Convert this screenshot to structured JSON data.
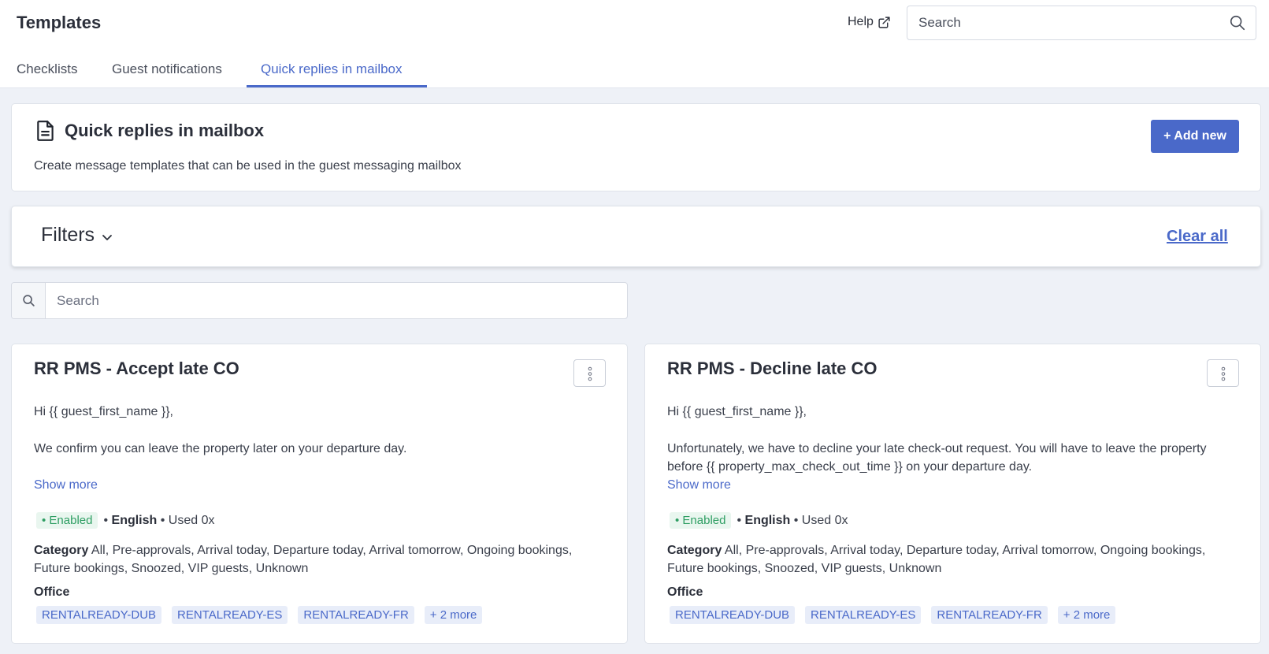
{
  "header": {
    "title": "Templates",
    "help_label": "Help",
    "search_placeholder": "Search"
  },
  "tabs": [
    {
      "label": "Checklists",
      "active": false
    },
    {
      "label": "Guest notifications",
      "active": false
    },
    {
      "label": "Quick replies in mailbox",
      "active": true
    }
  ],
  "section": {
    "title": "Quick replies in mailbox",
    "description": "Create message templates that can be used in the guest messaging mailbox",
    "add_button": "+ Add new"
  },
  "filters": {
    "label": "Filters",
    "clear_all": "Clear all"
  },
  "list_search": {
    "placeholder": "Search"
  },
  "templates": [
    {
      "title": "RR PMS - Accept late CO",
      "greeting": "Hi {{ guest_first_name }},",
      "body": "We confirm you can leave the property later on your departure day.",
      "show_more": "Show more",
      "status": "• Enabled",
      "language": "English",
      "used": "Used 0x",
      "category_label": "Category",
      "category_values": "All, Pre-approvals, Arrival today, Departure today, Arrival tomorrow, Ongoing bookings, Future bookings, Snoozed, VIP guests, Unknown",
      "office_label": "Office",
      "offices": [
        "RENTALREADY-DUB",
        "RENTALREADY-ES",
        "RENTALREADY-FR",
        "+ 2 more"
      ]
    },
    {
      "title": "RR PMS - Decline late CO",
      "greeting": "Hi {{ guest_first_name }},",
      "body": "Unfortunately, we have to decline your late check-out request. You will have to leave the property before {{ property_max_check_out_time }} on your departure day.",
      "show_more": "Show more",
      "status": "• Enabled",
      "language": "English",
      "used": "Used 0x",
      "category_label": "Category",
      "category_values": "All, Pre-approvals, Arrival today, Departure today, Arrival tomorrow, Ongoing bookings, Future bookings, Snoozed, VIP guests, Unknown",
      "office_label": "Office",
      "offices": [
        "RENTALREADY-DUB",
        "RENTALREADY-ES",
        "RENTALREADY-FR",
        "+ 2 more"
      ]
    }
  ],
  "colors": {
    "accent": "#4a69c9",
    "enabled_text": "#2e9e63",
    "enabled_bg": "#e9f6ef",
    "page_bg": "#eef1f7"
  }
}
